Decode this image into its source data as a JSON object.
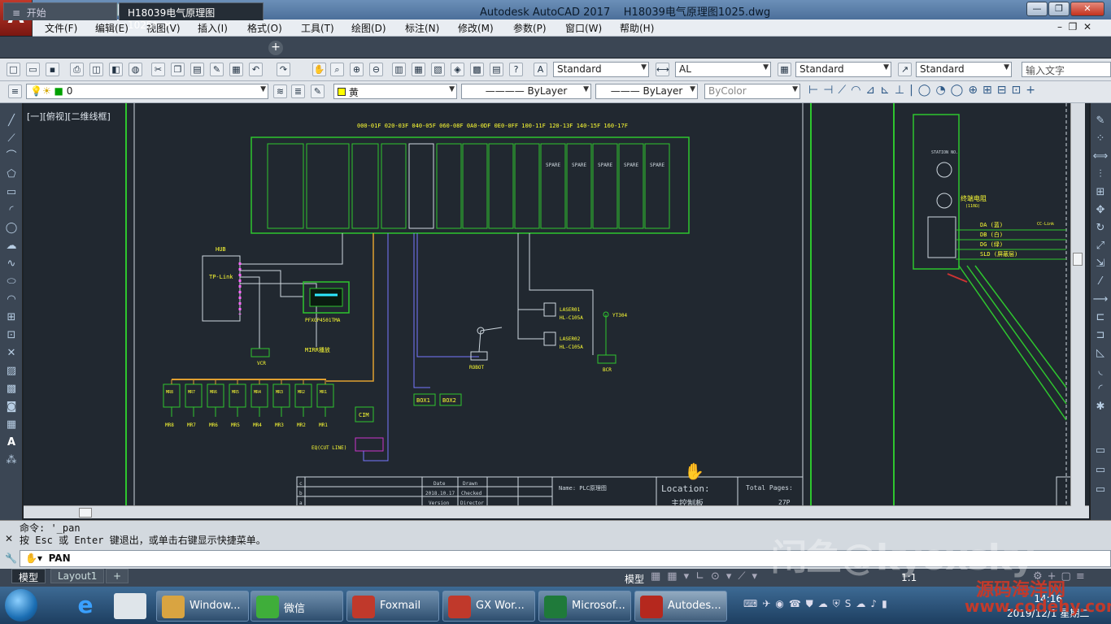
{
  "app": {
    "logo": "A",
    "title": "Autodesk AutoCAD 2017",
    "document": "H18039电气原理图1025.dwg"
  },
  "window_controls": {
    "minimize": "—",
    "maximize": "❐",
    "close": "✕"
  },
  "menu": [
    "文件(F)",
    "编辑(E)",
    "视图(V)",
    "插入(I)",
    "格式(O)",
    "工具(T)",
    "绘图(D)",
    "标注(N)",
    "修改(M)",
    "参数(P)",
    "窗口(W)",
    "帮助(H)"
  ],
  "doc_tabs": [
    {
      "label": "开始"
    },
    {
      "label": "H18039电气原理图1025*"
    }
  ],
  "toolbar_styles": {
    "text_style": "Standard",
    "dim_style": "AL",
    "table_style": "Standard",
    "mleader_style": "Standard",
    "search_placeholder": "输入文字"
  },
  "layers_bar": {
    "layer": "0",
    "color": "黄",
    "linetype": "ByLayer",
    "lineweight": "ByLayer",
    "plotstyle": "ByColor"
  },
  "view_label": "[一][俯视][二维线框]",
  "drawing": {
    "plc_header": "000-01F 020-03F 040-05F 060-08F 0A0-0DF 0E0-0FF 100-11F 120-13F 140-15F 160-17F",
    "spare": "SPARE",
    "hub": "HUB",
    "tplink": "TP-Link",
    "hmi": "PFXGP4501TMA",
    "vcr": "VCR",
    "mirr": "MIRR播放",
    "robot": "ROBOT",
    "box1": "BOX1",
    "box2": "BOX2",
    "cim": "CIM",
    "eq": "EQ(CUT LINE)",
    "laser1": "LASER01",
    "laser1_model": "HL-C105A",
    "laser2": "LASER02",
    "laser2_model": "HL-C105A",
    "yt": "YT304",
    "bcr": "BCR",
    "mr_top": [
      "MR8",
      "MR7",
      "MR6",
      "MR5",
      "MR4",
      "MR3",
      "MR2",
      "MR1"
    ],
    "mr_bottom": [
      "MR8",
      "MR7",
      "MR6",
      "MR5",
      "MR4",
      "MR3",
      "MR2",
      "MR1"
    ],
    "station": "STATION NO.",
    "terminal_resistor": "终端电阻",
    "resistor_val": "(110Ω)",
    "cc_link": "CC-Link",
    "wires": [
      "DA (蓝)",
      "DB (白)",
      "DG (绿)",
      "SLD (屏蔽层)"
    ],
    "titleblock": {
      "rows": [
        "c",
        "b",
        "a"
      ],
      "date_h": "Date",
      "drawn_h": "Drawn",
      "date": "2018.10.17",
      "checked": "Checked",
      "version": "Version",
      "director": "Director",
      "name": "Name: PLC原理图",
      "location": "Location:",
      "location_val": "主控制板",
      "total": "Total Pages:",
      "pages": "27P"
    }
  },
  "command": {
    "line1": "命令: '_pan",
    "line2": "按 Esc 或 Enter 键退出，或单击右键显示快捷菜单。",
    "input": "PAN"
  },
  "layout_tabs": [
    "模型",
    "Layout1",
    "+"
  ],
  "status": {
    "model": "模型",
    "scale": "1:1"
  },
  "taskbar": [
    {
      "label": "Window...",
      "color": "#d9a441"
    },
    {
      "label": "微信",
      "color": "#3fae3a"
    },
    {
      "label": "Foxmail",
      "color": "#c0392b"
    },
    {
      "label": "GX Wor...",
      "color": "#c0392b"
    },
    {
      "label": "Microsof...",
      "color": "#1f7a3a"
    },
    {
      "label": "Autodes...",
      "color": "#b5281e"
    }
  ],
  "clock": {
    "time": "14:16",
    "date": "2019/12/1 星期二"
  },
  "watermark": "闲鱼@kyoxsky",
  "site": {
    "name": "源码海洋网",
    "url": "www.codehy.com"
  }
}
